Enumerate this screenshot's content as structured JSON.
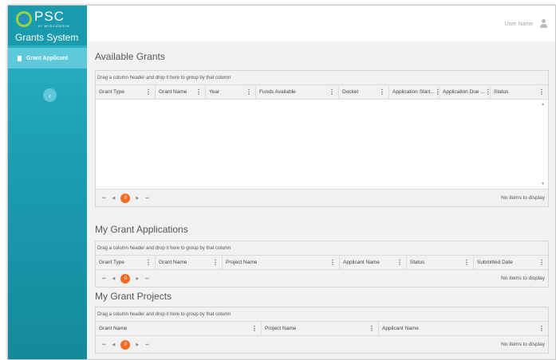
{
  "brand": {
    "logo_text": "PSC",
    "logo_sub": "of WISCONSIN",
    "app_name": "Grants System"
  },
  "sidebar": {
    "items": [
      {
        "label": "Grant Applicant"
      }
    ],
    "collapse_icon": "chevron-left-icon"
  },
  "header": {
    "user_name": "User Name",
    "user_icon": "user-icon"
  },
  "pager": {
    "current_page": "0",
    "empty_message": "No items to display"
  },
  "available_grants": {
    "title": "Available Grants",
    "group_hint": "Drag a column header and drop it here to group by that column",
    "columns": [
      "Grant Type",
      "Grant Name",
      "Year",
      "Funds Available",
      "Docket",
      "Application Start...",
      "Application Due ...",
      "Status"
    ]
  },
  "my_applications": {
    "title": "My Grant Applications",
    "group_hint": "Drag a column header and drop it here to group by that column",
    "columns": [
      "Grant Type",
      "Grant Name",
      "Project Name",
      "Applicant Name",
      "Status",
      "Submitted Date"
    ]
  },
  "my_projects": {
    "title": "My Grant Projects",
    "group_hint": "Drag a column header and drop it here to group by that column",
    "columns": [
      "Grant Name",
      "Project Name",
      "Applicant Name"
    ]
  }
}
